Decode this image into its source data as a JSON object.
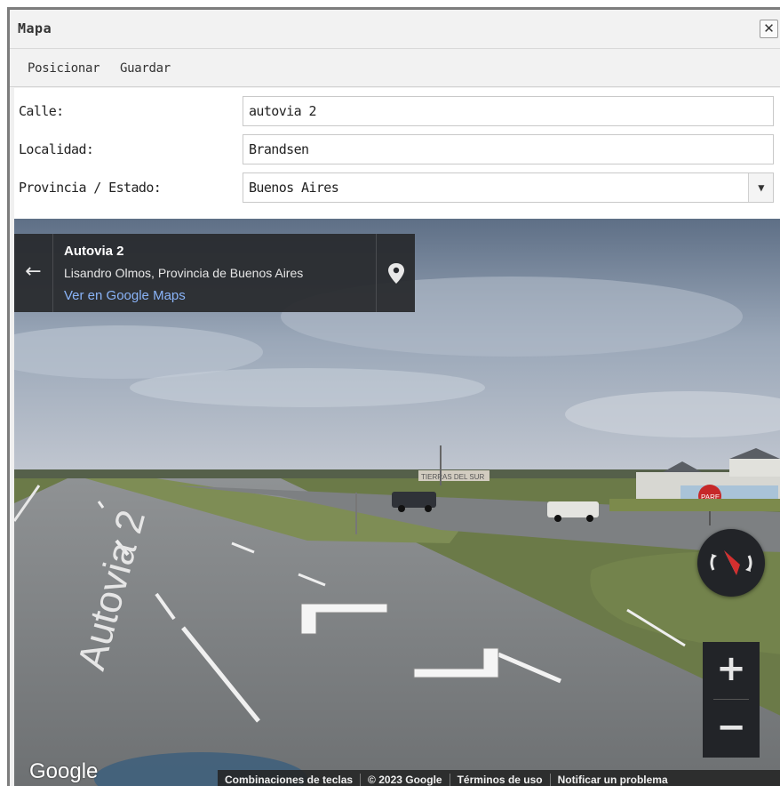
{
  "window": {
    "title": "Mapa",
    "close_glyph": "✕"
  },
  "menu": {
    "items": [
      "Posicionar",
      "Guardar"
    ]
  },
  "form": {
    "fields": [
      {
        "label": "Calle:",
        "value": "autovia 2"
      },
      {
        "label": "Localidad:",
        "value": "Brandsen"
      },
      {
        "label": "Provincia / Estado:",
        "value": "Buenos Aires",
        "type": "select"
      }
    ]
  },
  "streetview": {
    "card": {
      "title": "Autovia 2",
      "subtitle": "Lisandro Olmos, Provincia de Buenos Aires",
      "link": "Ver en Google Maps",
      "back_icon": "arrow-left-icon",
      "pin_icon": "map-pin-icon"
    },
    "road_marking": "Autovia 2",
    "stop_sign": "PARE",
    "billboard": "TIERRAS DEL SUR",
    "logo": "Google",
    "compass_icon": "compass-icon",
    "zoom_in": "+",
    "zoom_out": "−",
    "footer": [
      "Combinaciones de teclas",
      "© 2023 Google",
      "Términos de uso",
      "Notificar un problema"
    ]
  },
  "colors": {
    "card_bg": "#282a2e",
    "link": "#8ab4f8",
    "window_border": "#7d7d7d"
  }
}
